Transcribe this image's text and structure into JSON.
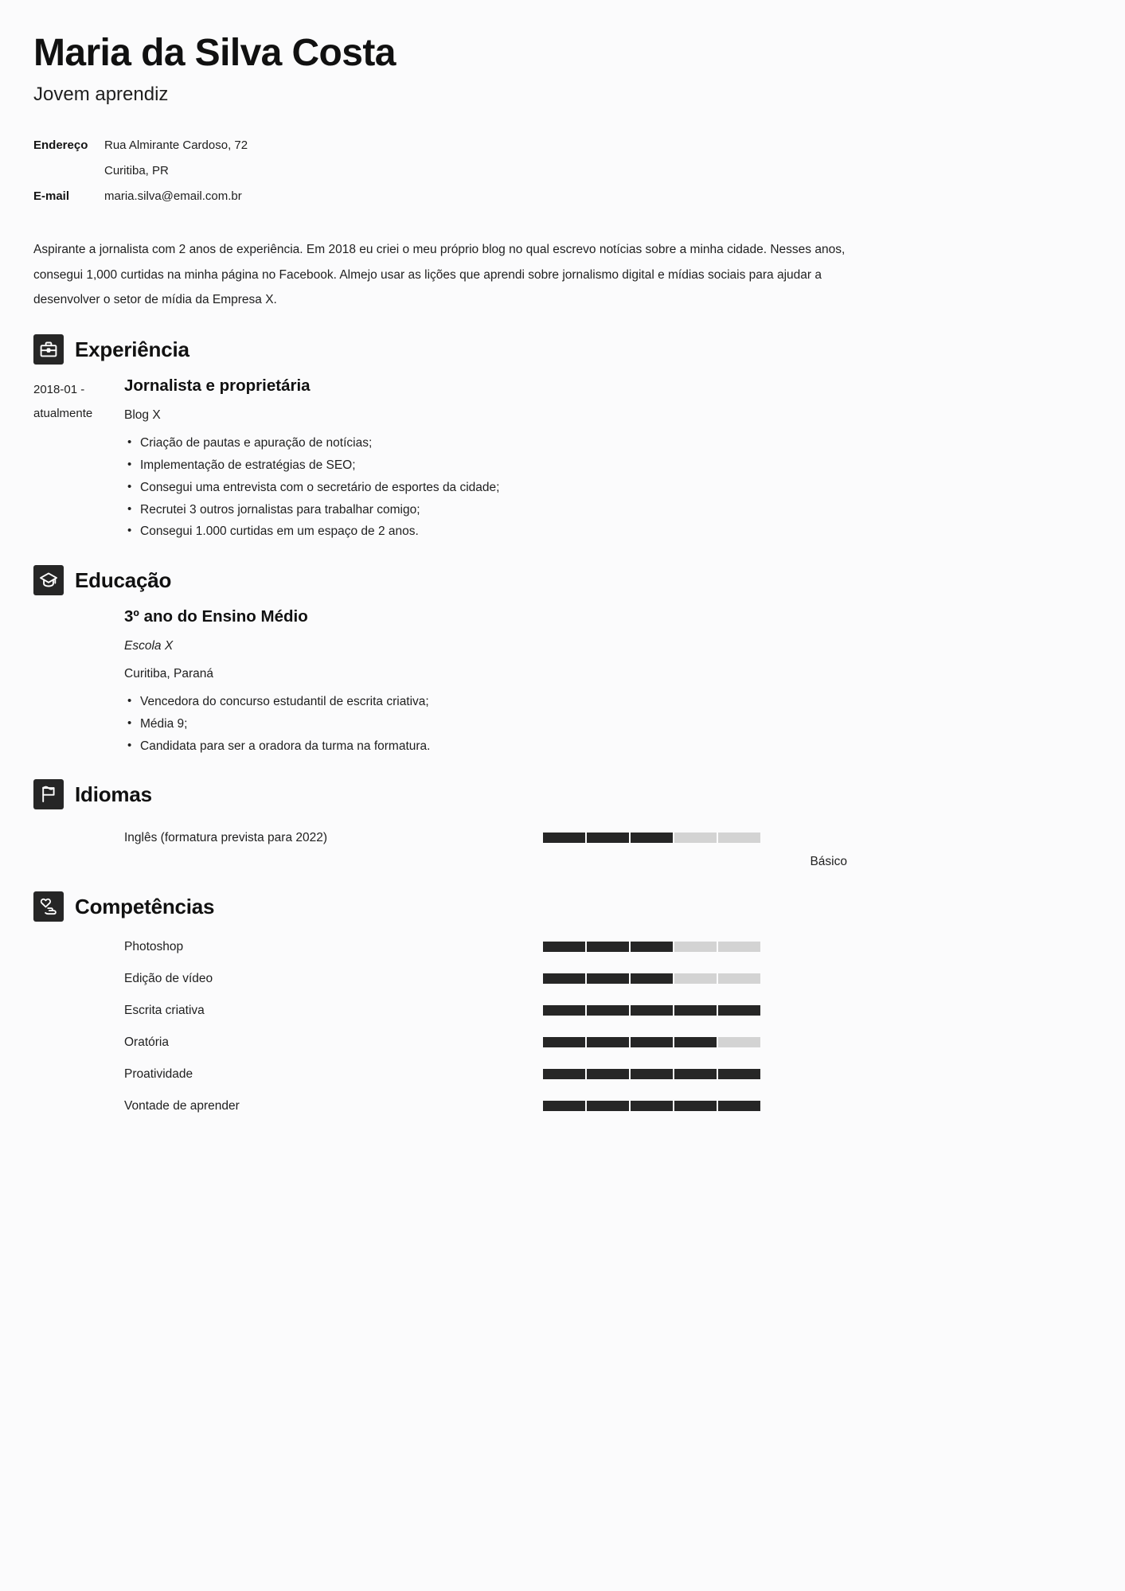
{
  "header": {
    "name": "Maria da Silva Costa",
    "job_title": "Jovem aprendiz"
  },
  "contact": {
    "address_label": "Endereço",
    "address_line1": "Rua Almirante Cardoso, 72",
    "address_line2": "Curitiba, PR",
    "email_label": "E-mail",
    "email_value": "maria.silva@email.com.br"
  },
  "summary": "Aspirante a jornalista com 2 anos de experiência. Em 2018 eu criei o meu próprio blog no qual escrevo notícias sobre a minha cidade. Nesses anos, consegui 1,000 curtidas na minha página no Facebook. Almejo usar as lições que aprendi sobre jornalismo digital e mídias sociais para ajudar a desenvolver o setor de mídia da Empresa X.",
  "sections": {
    "experience": {
      "title": "Experiência",
      "icon": "briefcase-icon",
      "entries": [
        {
          "date": "2018-01 -",
          "date_second": "atualmente",
          "role": "Jornalista e proprietária",
          "org": "Blog X",
          "bullets": [
            "Criação de pautas e apuração de notícias;",
            "Implementação de estratégias de SEO;",
            "Consegui uma entrevista com o secretário de esportes da cidade;",
            "Recrutei 3 outros jornalistas para trabalhar comigo;",
            "Consegui 1.000 curtidas em um espaço de 2 anos."
          ]
        }
      ]
    },
    "education": {
      "title": "Educação",
      "icon": "graduation-cap-icon",
      "entries": [
        {
          "degree": "3º ano do Ensino Médio",
          "school": "Escola X",
          "place": "Curitiba, Paraná",
          "bullets": [
            "Vencedora do concurso estudantil de escrita criativa;",
            "Média 9;",
            "Candidata para ser a oradora da turma na formatura."
          ]
        }
      ]
    },
    "languages": {
      "title": "Idiomas",
      "icon": "flag-icon",
      "items": [
        {
          "label": "Inglês (formatura prevista para 2022)",
          "level_percent": 60,
          "segments": 5
        }
      ],
      "caption": "Básico"
    },
    "skills": {
      "title": "Competências",
      "icon": "heart-hand-icon",
      "items": [
        {
          "label": "Photoshop",
          "level_percent": 60,
          "segments": 5
        },
        {
          "label": "Edição de vídeo",
          "level_percent": 60,
          "segments": 5
        },
        {
          "label": "Escrita criativa",
          "level_percent": 100,
          "segments": 5
        },
        {
          "label": "Oratória",
          "level_percent": 80,
          "segments": 5
        },
        {
          "label": "Proatividade",
          "level_percent": 100,
          "segments": 5
        },
        {
          "label": "Vontade de aprender",
          "level_percent": 100,
          "segments": 5
        }
      ]
    }
  },
  "colors": {
    "page_background": "#fbfbfc",
    "text": "#1f1f1f",
    "heading": "#111111",
    "icon_background": "#262626",
    "bar_filled": "#262626",
    "bar_empty": "#d3d3d3"
  }
}
